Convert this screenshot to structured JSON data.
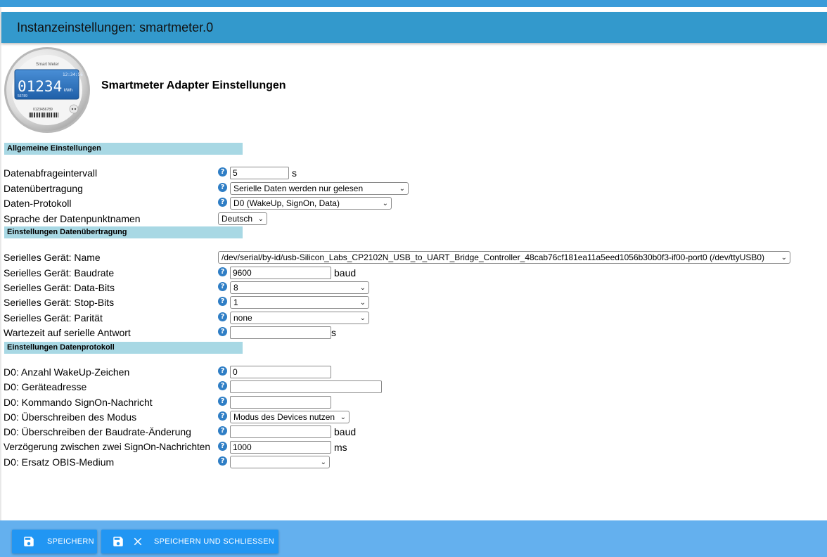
{
  "header": {
    "title": "Instanzeinstellungen: smartmeter.0"
  },
  "logo": {
    "brand": "Smart Meter",
    "time": "12:34:56",
    "reading": "01234",
    "unit": "kWh",
    "sub": "56789",
    "serial": "0123456789"
  },
  "page_title": "Smartmeter Adapter Einstellungen",
  "sections": {
    "general": "Allgemeine Einstellungen",
    "transfer": "Einstellungen Datenübertragung",
    "protocol": "Einstellungen Datenprotokoll"
  },
  "help_glyph": "?",
  "general": {
    "interval": {
      "label": "Datenabfrageintervall",
      "value": "5",
      "unit": "s"
    },
    "transfer": {
      "label": "Datenübertragung",
      "value": "Serielle Daten werden nur gelesen"
    },
    "protocol": {
      "label": "Daten-Protokoll",
      "value": "D0 (WakeUp, SignOn, Data)"
    },
    "language": {
      "label": "Sprache der Datenpunktnamen",
      "value": "Deutsch"
    }
  },
  "serial": {
    "name": {
      "label": "Serielles Gerät: Name",
      "value": "/dev/serial/by-id/usb-Silicon_Labs_CP2102N_USB_to_UART_Bridge_Controller_48cab76cf181ea11a5eed1056b30b0f3-if00-port0 (/dev/ttyUSB0)"
    },
    "baud": {
      "label": "Serielles Gerät: Baudrate",
      "value": "9600",
      "unit": "baud"
    },
    "databits": {
      "label": "Serielles Gerät: Data-Bits",
      "value": "8"
    },
    "stopbits": {
      "label": "Serielles Gerät: Stop-Bits",
      "value": "1"
    },
    "parity": {
      "label": "Serielles Gerät: Parität",
      "value": "none"
    },
    "wait": {
      "label": "Wartezeit auf serielle Antwort",
      "value": "",
      "unit": "s"
    }
  },
  "d0": {
    "wakeup": {
      "label": "D0: Anzahl WakeUp-Zeichen",
      "value": "0"
    },
    "address": {
      "label": "D0: Geräteadresse",
      "value": ""
    },
    "signon": {
      "label": "D0: Kommando SignOn-Nachricht",
      "value": ""
    },
    "mode": {
      "label": "D0: Überschreiben des Modus",
      "value": "Modus des Devices nutzen"
    },
    "baudchange": {
      "label": "D0: Überschreiben der Baudrate-Änderung",
      "value": "",
      "unit": "baud"
    },
    "delay": {
      "label": "Verzögerung zwischen zwei SignOn-Nachrichten",
      "value": "1000",
      "unit": "ms"
    },
    "obis": {
      "label": "D0: Ersatz OBIS-Medium",
      "value": ""
    }
  },
  "footer": {
    "save": "SPEICHERN",
    "save_close": "SPEICHERN UND SCHLIESSEN"
  },
  "colors": {
    "header": "#3399cc",
    "section": "#a8d8e4",
    "footer": "#64b0ee",
    "button": "#2196f3"
  },
  "icons": [
    "help-icon",
    "save-icon",
    "close-icon",
    "chevron-down-icon"
  ]
}
